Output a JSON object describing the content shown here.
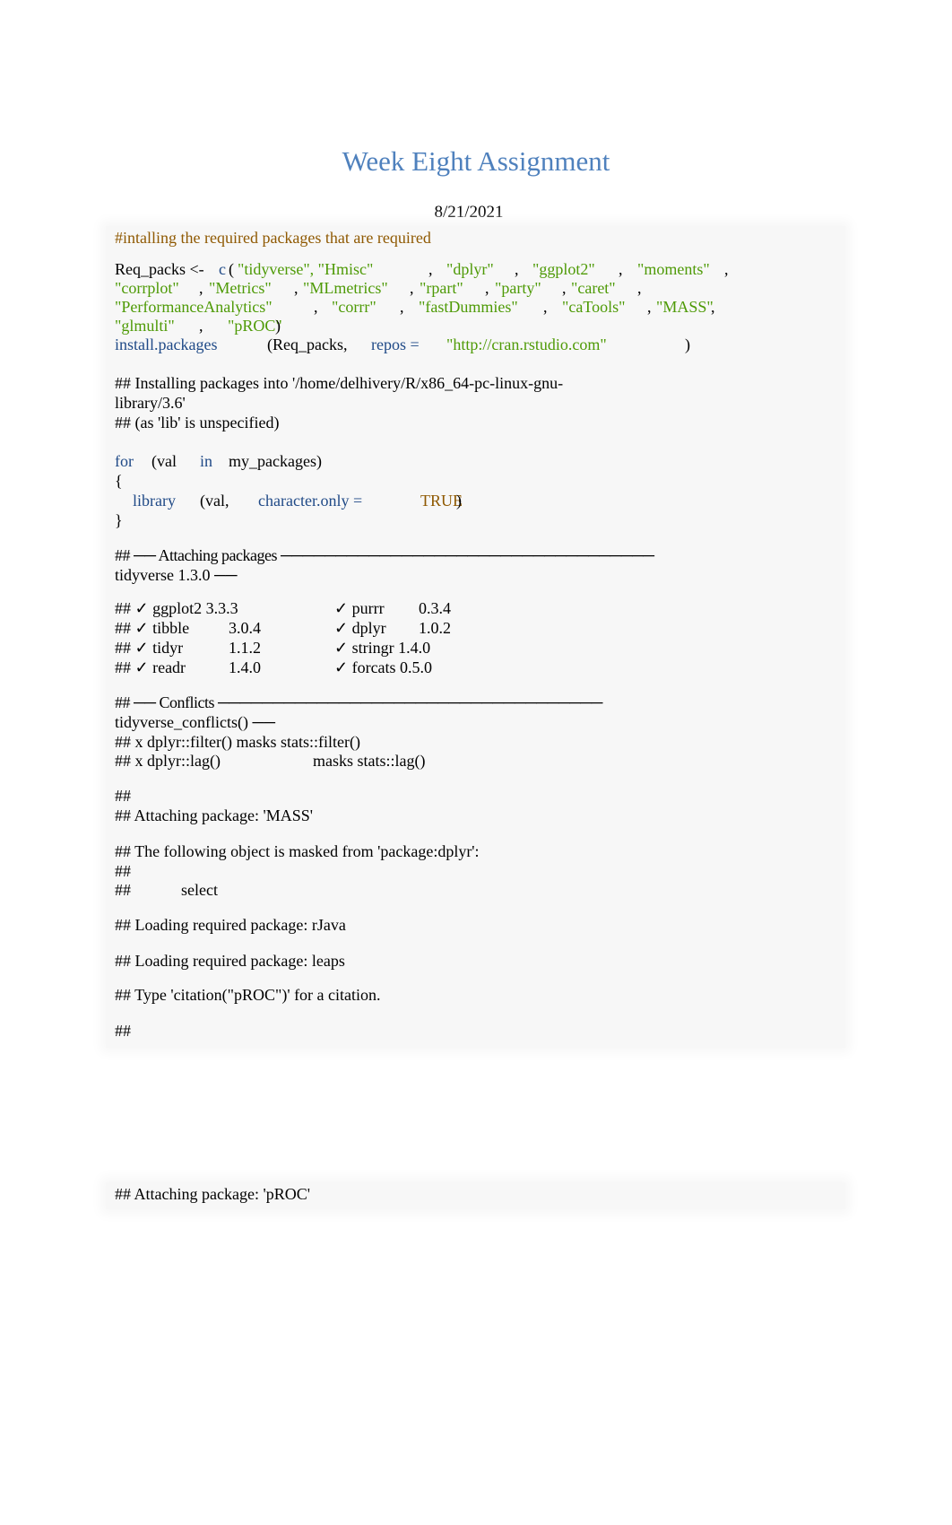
{
  "document": {
    "title": "Week Eight Assignment",
    "date": "8/21/2021"
  },
  "code": {
    "comment": "#intalling the required packages that are required",
    "assign_var": "Req_packs <-",
    "c_fn": "c",
    "open_paren": "(",
    "packages": [
      "\"tidyverse\", \"Hmisc\"",
      "\"dplyr\"",
      "\"ggplot2\"",
      "\"moments\"",
      "\"corrplot\"",
      "\"Metrics\"",
      "\"MLmetrics\"",
      "\"rpart\"",
      "\"party\"",
      "\"caret\"",
      "\"PerformanceAnalytics\"",
      "\"corrr\"",
      "\"fastDummies\"",
      "\"caTools\"",
      "\"MASS\"",
      "\"glmulti\"",
      "\"pROC\""
    ],
    "comma": ",",
    "close_paren": ")",
    "install_fn": "install.packages",
    "install_arg": "(Req_packs,",
    "repos_kw": "repos =",
    "repos_val": "\"http://cran.rstudio.com\"",
    "install_close": ")",
    "for_kw": "for",
    "for_var": "(val",
    "in_kw": "in",
    "for_iter": "my_packages)",
    "open_brace": "{",
    "library_fn": "library",
    "library_arg": "(val,",
    "char_only": "character.only =",
    "true_val": "TRUE",
    "close_brace": "}"
  },
  "output": {
    "install_msg_1": "## Installing packages into '/home/delhivery/R/x86_64-pc-linux-gnu-",
    "install_msg_2": "library/3.6'",
    "install_msg_3": "## (as 'lib' is unspecified)",
    "attach_header_1": "## ── Attaching packages ──────────────────────────────────",
    "attach_header_2": "tidyverse 1.3.0 ──",
    "attached": [
      {
        "left_name": "## ✓ ggplot2 3.3.3",
        "left_ver": "",
        "right_name": "✓ purrr",
        "right_ver": "0.3.4"
      },
      {
        "left_name": "## ✓ tibble",
        "left_ver": "3.0.4",
        "right_name": "✓ dplyr",
        "right_ver": "1.0.2"
      },
      {
        "left_name": "## ✓ tidyr",
        "left_ver": "1.1.2",
        "right_name": "✓ stringr 1.4.0",
        "right_ver": ""
      },
      {
        "left_name": "## ✓ readr",
        "left_ver": "1.4.0",
        "right_name": "✓ forcats 0.5.0",
        "right_ver": ""
      }
    ],
    "conflicts_header_1": "## ── Conflicts ───────────────────────────────────",
    "conflicts_header_2": "tidyverse_conflicts() ──",
    "conflict_1": "## x dplyr::filter() masks stats::filter()",
    "conflict_2_left": "## x dplyr::lag()",
    "conflict_2_right": "masks stats::lag()",
    "hash_blank": "##",
    "attach_mass": "## Attaching package: 'MASS'",
    "masked_from": "## The following object is masked from 'package:dplyr':",
    "hash_blank_2": "##",
    "select_hash": "##",
    "select_word": "select",
    "load_rjava": "## Loading required package: rJava",
    "load_leaps": "## Loading required package: leaps",
    "citation": "## Type 'citation(\"pROC\")' for a citation.",
    "hash_end": "##",
    "attach_proc": "## Attaching package: 'pROC'"
  }
}
